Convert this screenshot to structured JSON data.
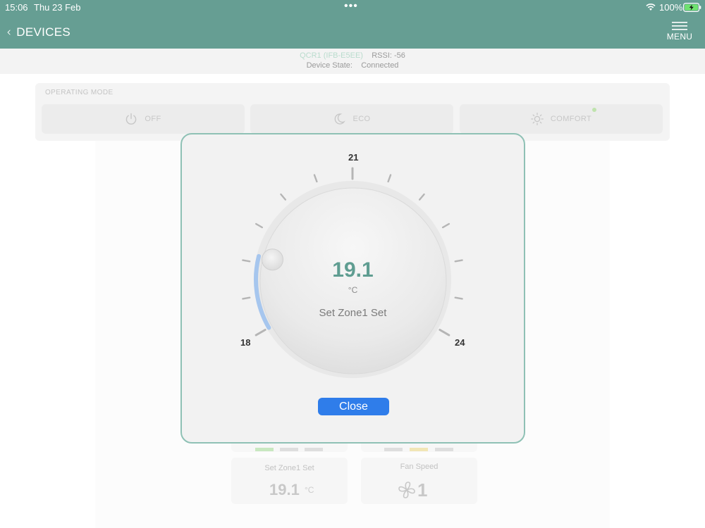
{
  "status_bar": {
    "time": "15:06",
    "date": "Thu 23 Feb",
    "dots": "•••",
    "battery_pct": "100%"
  },
  "navbar": {
    "back_label": "DEVICES",
    "menu_label": "MENU"
  },
  "device_info": {
    "name": "QCR1 (IFB-E5EE)",
    "rssi": "RSSI: -56",
    "state_label": "Device State:",
    "state_value": "Connected"
  },
  "operating_mode": {
    "title": "OPERATING MODE",
    "buttons": [
      {
        "label": "OFF"
      },
      {
        "label": "ECO"
      },
      {
        "label": "COMFORT"
      }
    ]
  },
  "cards": {
    "zone_set": {
      "label": "Set Zone1 Set",
      "value": "19.1",
      "unit": "°C"
    },
    "fan_speed": {
      "label": "Fan Speed",
      "value": "1"
    }
  },
  "dial": {
    "value": "19.1",
    "unit": "°C",
    "label": "Set Zone1 Set",
    "min_label": "18",
    "mid_label": "21",
    "max_label": "24",
    "min": 18,
    "max": 24,
    "accent_color": "#5f9d91",
    "arc_color": "#a6c6ee"
  },
  "modal": {
    "close_label": "Close"
  }
}
